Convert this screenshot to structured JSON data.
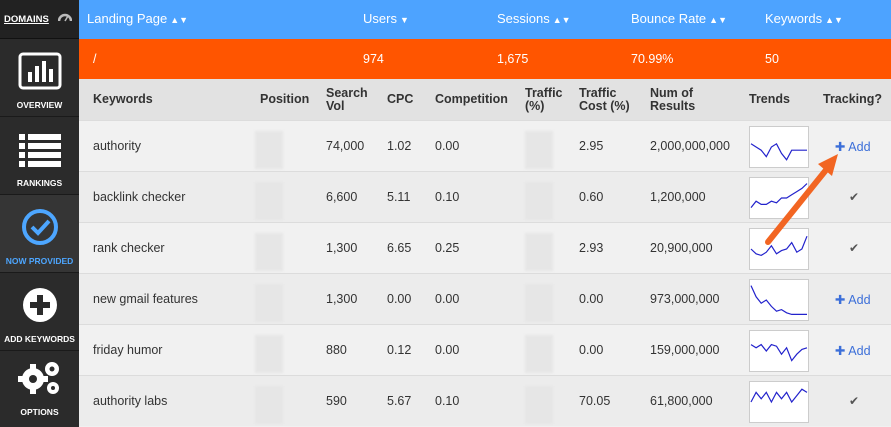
{
  "sidebar": {
    "domains_label": "DOMAINS",
    "items": [
      {
        "label": "OVERVIEW",
        "icon": "bar-chart-icon"
      },
      {
        "label": "RANKINGS",
        "icon": "list-icon"
      },
      {
        "label": "NOW PROVIDED",
        "icon": "check-circle-icon"
      },
      {
        "label": "ADD KEYWORDS",
        "icon": "plus-circle-icon"
      },
      {
        "label": "OPTIONS",
        "icon": "gears-icon"
      }
    ]
  },
  "topbar": {
    "landing_page": "Landing Page",
    "users": "Users",
    "sessions": "Sessions",
    "bounce_rate": "Bounce Rate",
    "keywords": "Keywords"
  },
  "summary": {
    "page": "/",
    "users": "974",
    "sessions": "1,675",
    "bounce_rate": "70.99%",
    "keywords": "50"
  },
  "columns": {
    "keywords": "Keywords",
    "position": "Position",
    "search_vol_1": "Search",
    "search_vol_2": "Vol",
    "cpc": "CPC",
    "competition": "Competition",
    "traffic_1": "Traffic",
    "traffic_2": "(%)",
    "traffic_cost_1": "Traffic",
    "traffic_cost_2": "Cost (%)",
    "num_results_1": "Num of",
    "num_results_2": "Results",
    "trends": "Trends",
    "tracking": "Tracking?"
  },
  "rows": [
    {
      "keyword": "authority",
      "search_vol": "74,000",
      "cpc": "1.02",
      "competition": "0.00",
      "traffic_cost": "2.95",
      "results": "2,000,000,000",
      "tracking": "add",
      "add_label": "Add",
      "trend": [
        0.6,
        0.5,
        0.4,
        0.2,
        0.5,
        0.6,
        0.3,
        0.1,
        0.4,
        0.4,
        0.4,
        0.4
      ]
    },
    {
      "keyword": "backlink checker",
      "search_vol": "6,600",
      "cpc": "5.11",
      "competition": "0.10",
      "traffic_cost": "0.60",
      "results": "1,200,000",
      "tracking": "tracked",
      "add_label": "",
      "trend": [
        0.2,
        0.4,
        0.3,
        0.3,
        0.4,
        0.35,
        0.5,
        0.5,
        0.6,
        0.7,
        0.8,
        0.95
      ]
    },
    {
      "keyword": "rank checker",
      "search_vol": "1,300",
      "cpc": "6.65",
      "competition": "0.25",
      "traffic_cost": "2.93",
      "results": "20,900,000",
      "tracking": "tracked",
      "add_label": "",
      "trend": [
        0.5,
        0.35,
        0.3,
        0.4,
        0.6,
        0.35,
        0.45,
        0.5,
        0.7,
        0.4,
        0.5,
        0.9
      ]
    },
    {
      "keyword": "new gmail features",
      "search_vol": "1,300",
      "cpc": "0.00",
      "competition": "0.00",
      "traffic_cost": "0.00",
      "results": "973,000,000",
      "tracking": "add",
      "add_label": "Add",
      "trend": [
        0.95,
        0.6,
        0.4,
        0.5,
        0.3,
        0.15,
        0.2,
        0.1,
        0.05,
        0.05,
        0.05,
        0.05
      ]
    },
    {
      "keyword": "friday humor",
      "search_vol": "880",
      "cpc": "0.12",
      "competition": "0.00",
      "traffic_cost": "0.00",
      "results": "159,000,000",
      "tracking": "add",
      "add_label": "Add",
      "trend": [
        0.7,
        0.6,
        0.7,
        0.5,
        0.7,
        0.65,
        0.4,
        0.6,
        0.2,
        0.4,
        0.55,
        0.6
      ]
    },
    {
      "keyword": "authority labs",
      "search_vol": "590",
      "cpc": "5.67",
      "competition": "0.10",
      "traffic_cost": "70.05",
      "results": "61,800,000",
      "tracking": "tracked",
      "add_label": "",
      "trend": [
        0.5,
        0.8,
        0.6,
        0.8,
        0.5,
        0.8,
        0.6,
        0.8,
        0.5,
        0.7,
        0.9,
        0.8
      ]
    }
  ],
  "colors": {
    "topbar": "#4da3ff",
    "summary": "#ff5500",
    "add_link": "#3c6fd9",
    "arrow": "#f26522",
    "trend_line": "#2222cc"
  }
}
